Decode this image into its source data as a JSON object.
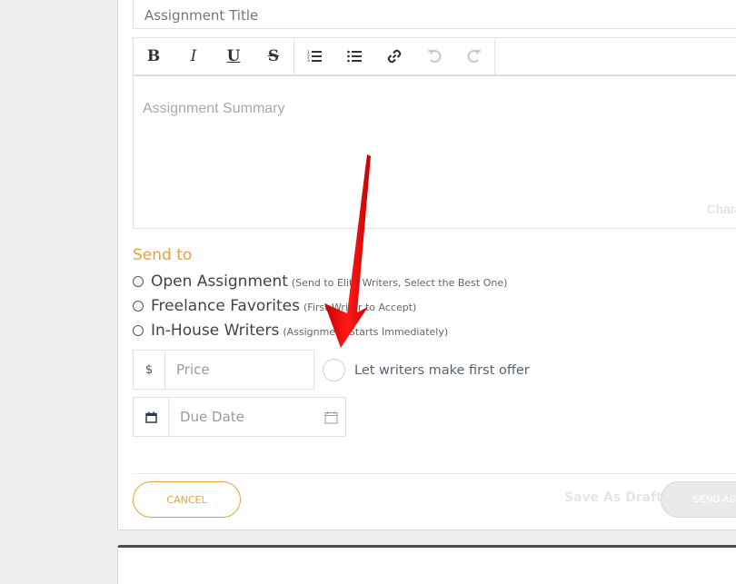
{
  "form": {
    "title_placeholder": "Assignment Title",
    "toolbar": {
      "bold": "B",
      "italic": "I",
      "underline": "U",
      "strikethrough": "S",
      "icons": [
        "bold-icon",
        "italic-icon",
        "underline-icon",
        "strikethrough-icon",
        "ordered-list-icon",
        "bullet-list-icon",
        "link-icon",
        "undo-icon",
        "redo-icon"
      ]
    },
    "summary_placeholder": "Assignment Summary",
    "char_counter": "Chara",
    "send_to": {
      "label": "Send to",
      "options": [
        {
          "label": "Open Assignment",
          "note": "(Send to Elite Writers, Select the Best One)",
          "selected": false
        },
        {
          "label": "Freelance Favorites",
          "note": "(First Writer to Accept)",
          "selected": false
        },
        {
          "label": "In-House Writers",
          "note": "(Assignment Starts Immediately)",
          "selected": false
        }
      ]
    },
    "price": {
      "prefix": "$",
      "placeholder": "Price"
    },
    "first_offer": {
      "label": "Let writers make first offer",
      "checked": false
    },
    "due_date": {
      "placeholder": "Due Date"
    },
    "actions": {
      "cancel": "CANCEL",
      "save_draft": "Save As Draft",
      "send": "SEND ASSIGNMENT"
    }
  },
  "colors": {
    "accent": "#e8a13a",
    "annotation_arrow": "#e00000",
    "background": "#efefef"
  }
}
